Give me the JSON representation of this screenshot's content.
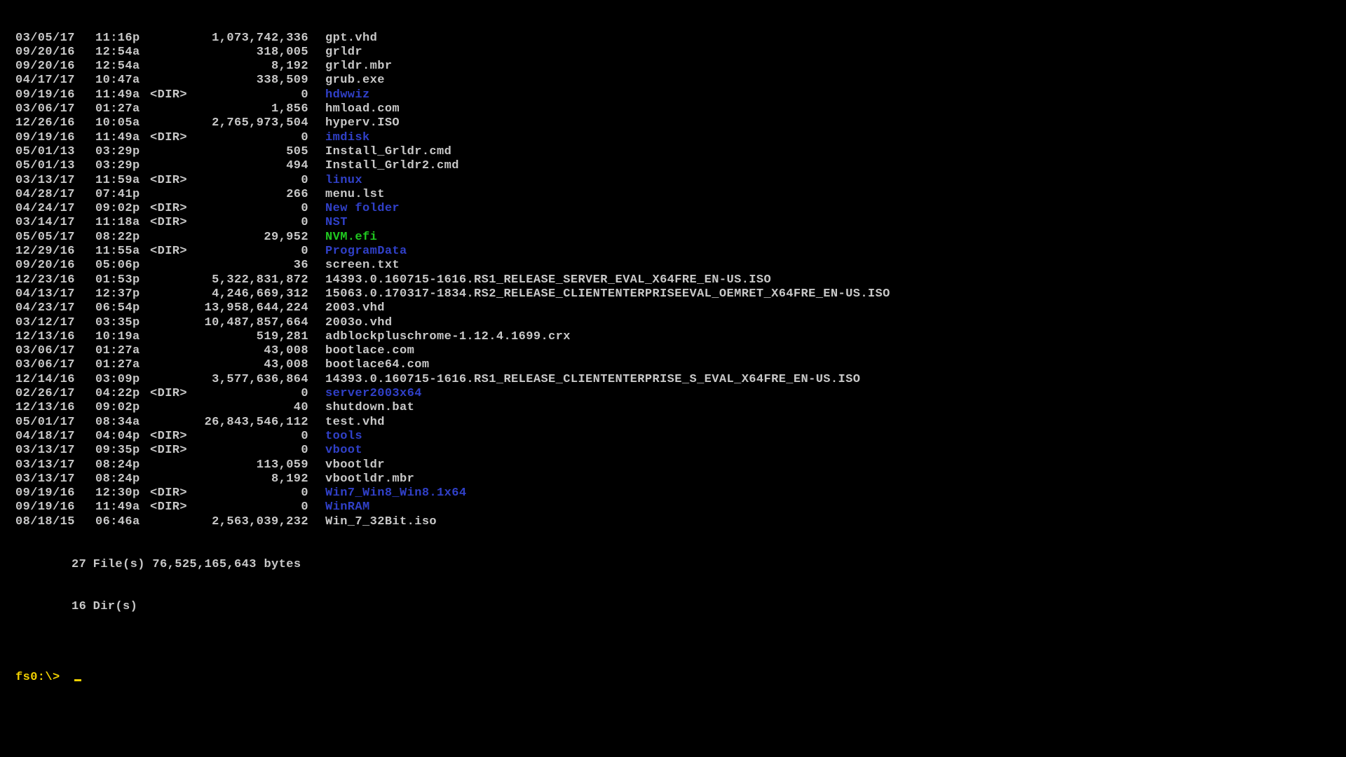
{
  "entries": [
    {
      "date": "03/05/17",
      "time": "11:16p",
      "dir": "",
      "size": "1,073,742,336",
      "name": "gpt.vhd",
      "style": "file"
    },
    {
      "date": "09/20/16",
      "time": "12:54a",
      "dir": "",
      "size": "318,005",
      "name": "grldr",
      "style": "file"
    },
    {
      "date": "09/20/16",
      "time": "12:54a",
      "dir": "",
      "size": "8,192",
      "name": "grldr.mbr",
      "style": "file"
    },
    {
      "date": "04/17/17",
      "time": "10:47a",
      "dir": "",
      "size": "338,509",
      "name": "grub.exe",
      "style": "file"
    },
    {
      "date": "09/19/16",
      "time": "11:49a",
      "dir": "<DIR>",
      "size": "0",
      "name": "hdwwiz",
      "style": "dir"
    },
    {
      "date": "03/06/17",
      "time": "01:27a",
      "dir": "",
      "size": "1,856",
      "name": "hmload.com",
      "style": "file"
    },
    {
      "date": "12/26/16",
      "time": "10:05a",
      "dir": "",
      "size": "2,765,973,504",
      "name": "hyperv.ISO",
      "style": "file"
    },
    {
      "date": "09/19/16",
      "time": "11:49a",
      "dir": "<DIR>",
      "size": "0",
      "name": "imdisk",
      "style": "dir"
    },
    {
      "date": "05/01/13",
      "time": "03:29p",
      "dir": "",
      "size": "505",
      "name": "Install_Grldr.cmd",
      "style": "file"
    },
    {
      "date": "05/01/13",
      "time": "03:29p",
      "dir": "",
      "size": "494",
      "name": "Install_Grldr2.cmd",
      "style": "file"
    },
    {
      "date": "03/13/17",
      "time": "11:59a",
      "dir": "<DIR>",
      "size": "0",
      "name": "linux",
      "style": "dir"
    },
    {
      "date": "04/28/17",
      "time": "07:41p",
      "dir": "",
      "size": "266",
      "name": "menu.lst",
      "style": "file"
    },
    {
      "date": "04/24/17",
      "time": "09:02p",
      "dir": "<DIR>",
      "size": "0",
      "name": "New folder",
      "style": "dir"
    },
    {
      "date": "03/14/17",
      "time": "11:18a",
      "dir": "<DIR>",
      "size": "0",
      "name": "NST",
      "style": "dir"
    },
    {
      "date": "05/05/17",
      "time": "08:22p",
      "dir": "",
      "size": "29,952",
      "name": "NVM.efi",
      "style": "exe"
    },
    {
      "date": "12/29/16",
      "time": "11:55a",
      "dir": "<DIR>",
      "size": "0",
      "name": "ProgramData",
      "style": "dir"
    },
    {
      "date": "09/20/16",
      "time": "05:06p",
      "dir": "",
      "size": "36",
      "name": "screen.txt",
      "style": "file"
    },
    {
      "date": "12/23/16",
      "time": "01:53p",
      "dir": "",
      "size": "5,322,831,872",
      "name": "14393.0.160715-1616.RS1_RELEASE_SERVER_EVAL_X64FRE_EN-US.ISO",
      "style": "file"
    },
    {
      "date": "04/13/17",
      "time": "12:37p",
      "dir": "",
      "size": "4,246,669,312",
      "name": "15063.0.170317-1834.RS2_RELEASE_CLIENTENTERPRISEEVAL_OEMRET_X64FRE_EN-US.ISO",
      "style": "file"
    },
    {
      "date": "04/23/17",
      "time": "06:54p",
      "dir": "",
      "size": "13,958,644,224",
      "name": "2003.vhd",
      "style": "file"
    },
    {
      "date": "03/12/17",
      "time": "03:35p",
      "dir": "",
      "size": "10,487,857,664",
      "name": "2003o.vhd",
      "style": "file"
    },
    {
      "date": "12/13/16",
      "time": "10:19a",
      "dir": "",
      "size": "519,281",
      "name": "adblockpluschrome-1.12.4.1699.crx",
      "style": "file"
    },
    {
      "date": "03/06/17",
      "time": "01:27a",
      "dir": "",
      "size": "43,008",
      "name": "bootlace.com",
      "style": "file"
    },
    {
      "date": "03/06/17",
      "time": "01:27a",
      "dir": "",
      "size": "43,008",
      "name": "bootlace64.com",
      "style": "file"
    },
    {
      "date": "12/14/16",
      "time": "03:09p",
      "dir": "",
      "size": "3,577,636,864",
      "name": "14393.0.160715-1616.RS1_RELEASE_CLIENTENTERPRISE_S_EVAL_X64FRE_EN-US.ISO",
      "style": "file"
    },
    {
      "date": "02/26/17",
      "time": "04:22p",
      "dir": "<DIR>",
      "size": "0",
      "name": "server2003x64",
      "style": "dir"
    },
    {
      "date": "12/13/16",
      "time": "09:02p",
      "dir": "",
      "size": "40",
      "name": "shutdown.bat",
      "style": "file"
    },
    {
      "date": "05/01/17",
      "time": "08:34a",
      "dir": "",
      "size": "26,843,546,112",
      "name": "test.vhd",
      "style": "file"
    },
    {
      "date": "04/18/17",
      "time": "04:04p",
      "dir": "<DIR>",
      "size": "0",
      "name": "tools",
      "style": "dir"
    },
    {
      "date": "03/13/17",
      "time": "09:35p",
      "dir": "<DIR>",
      "size": "0",
      "name": "vboot",
      "style": "dir"
    },
    {
      "date": "03/13/17",
      "time": "08:24p",
      "dir": "",
      "size": "113,059",
      "name": "vbootldr",
      "style": "file"
    },
    {
      "date": "03/13/17",
      "time": "08:24p",
      "dir": "",
      "size": "8,192",
      "name": "vbootldr.mbr",
      "style": "file"
    },
    {
      "date": "09/19/16",
      "time": "12:30p",
      "dir": "<DIR>",
      "size": "0",
      "name": "Win7_Win8_Win8.1x64",
      "style": "dir"
    },
    {
      "date": "09/19/16",
      "time": "11:49a",
      "dir": "<DIR>",
      "size": "0",
      "name": "WinRAM",
      "style": "dir"
    },
    {
      "date": "08/18/15",
      "time": "06:46a",
      "dir": "",
      "size": "2,563,039,232",
      "name": "Win_7_32Bit.iso",
      "style": "file"
    }
  ],
  "summary": {
    "file_count": "27",
    "file_line": " File(s) 76,525,165,643 bytes",
    "dir_count": "16",
    "dir_line": " Dir(s)"
  },
  "prompt": "fs0:\\> "
}
